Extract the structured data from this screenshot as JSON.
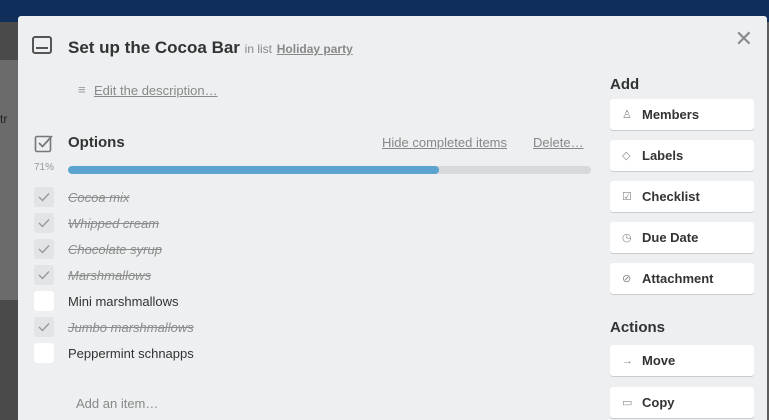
{
  "background": {
    "snippet": "tr"
  },
  "card": {
    "title": "Set up the Cocoa Bar",
    "in_list_prefix": "in list",
    "list_name": "Holiday party",
    "description_link": "Edit the description…"
  },
  "checklist": {
    "title": "Options",
    "hide_completed": "Hide completed items",
    "delete": "Delete…",
    "progress_label": "71%",
    "progress": 0.71,
    "items": [
      {
        "label": "Cocoa mix",
        "done": true
      },
      {
        "label": "Whipped cream",
        "done": true
      },
      {
        "label": "Chocolate syrup",
        "done": true
      },
      {
        "label": "Marshmallows",
        "done": true
      },
      {
        "label": "Mini marshmallows",
        "done": false
      },
      {
        "label": "Jumbo marshmallows",
        "done": true
      },
      {
        "label": "Peppermint schnapps",
        "done": false
      }
    ],
    "add_item": "Add an item…"
  },
  "sidebar": {
    "add_heading": "Add",
    "add_buttons": [
      {
        "label": "Members",
        "icon": "person-icon"
      },
      {
        "label": "Labels",
        "icon": "tag-icon"
      },
      {
        "label": "Checklist",
        "icon": "checkbox-icon"
      },
      {
        "label": "Due Date",
        "icon": "clock-icon"
      },
      {
        "label": "Attachment",
        "icon": "paperclip-icon"
      }
    ],
    "actions_heading": "Actions",
    "action_buttons": [
      {
        "label": "Move",
        "icon": "arrow-right-icon"
      },
      {
        "label": "Copy",
        "icon": "card-icon"
      }
    ]
  },
  "colors": {
    "progress_fill": "#5ba4cf",
    "progress_track": "#d6dadc",
    "panel": "#edeff0"
  }
}
